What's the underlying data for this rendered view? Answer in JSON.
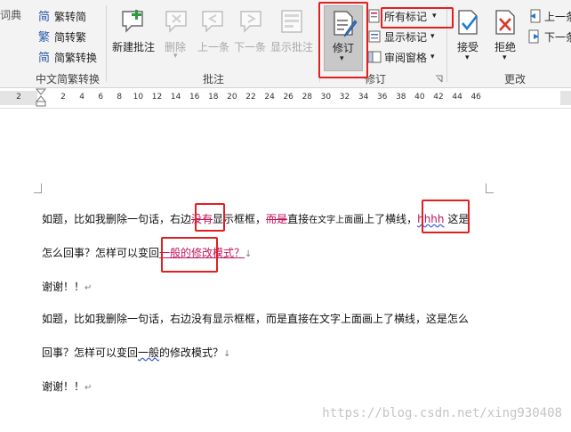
{
  "ribbon": {
    "cut_left_label": "词典",
    "chinese_convert": {
      "to_traditional": "繁转简",
      "to_simplified": "简转繁",
      "convert": "简繁转换",
      "group_label": "中文简繁转换"
    },
    "comments": {
      "new_comment": "新建批注",
      "delete": "删除",
      "previous": "上一条",
      "next": "下一条",
      "show_comments": "显示批注",
      "group_label": "批注"
    },
    "tracking": {
      "track_changes": "修订",
      "markup_select": "所有标记",
      "show_markup": "显示标记",
      "reviewing_pane": "审阅窗格",
      "group_label": "修订"
    },
    "changes": {
      "accept": "接受",
      "reject": "拒绝",
      "previous": "上一条",
      "next": "下一条",
      "group_label": "更改"
    }
  },
  "ruler": {
    "left_numbers": [
      "2"
    ],
    "numbers": [
      "2",
      "4",
      "6",
      "8",
      "10",
      "12",
      "14",
      "16",
      "18",
      "20",
      "22",
      "24",
      "26",
      "28",
      "30",
      "32",
      "34",
      "36",
      "38",
      "40",
      "42",
      "44",
      "46"
    ]
  },
  "document": {
    "p1": {
      "a": "如题，比如我删除一句话，右边",
      "del1": "没有",
      "b": "显示框框，",
      "del2": "而是",
      "c": "直接",
      "c_small": "在文字上面",
      "d": "画上了横线，",
      "ins": "hhhh",
      "e": " 这是"
    },
    "p2": {
      "a": "怎么回事？怎样可以变回",
      "ins": "一般的修改模式？",
      "mark": "↓"
    },
    "p3": {
      "text": "谢谢！！",
      "mark": "↵"
    },
    "p4": {
      "text": "如题，比如我删除一句话，右边没有显示框框，而是直接在文字上面画上了横线，这是怎么"
    },
    "p5": {
      "a": "回事？怎样可以变回",
      "wave": "一般",
      "b": "的修改模式？",
      "mark": "↓"
    },
    "p6": {
      "text": "谢谢！！",
      "mark": "↵"
    }
  },
  "watermark": "https://blog.csdn.net/xing930408",
  "colors": {
    "revision": "#c0145a",
    "highlight_box": "#e02020",
    "ribbon_bg": "#f3f3f3"
  }
}
